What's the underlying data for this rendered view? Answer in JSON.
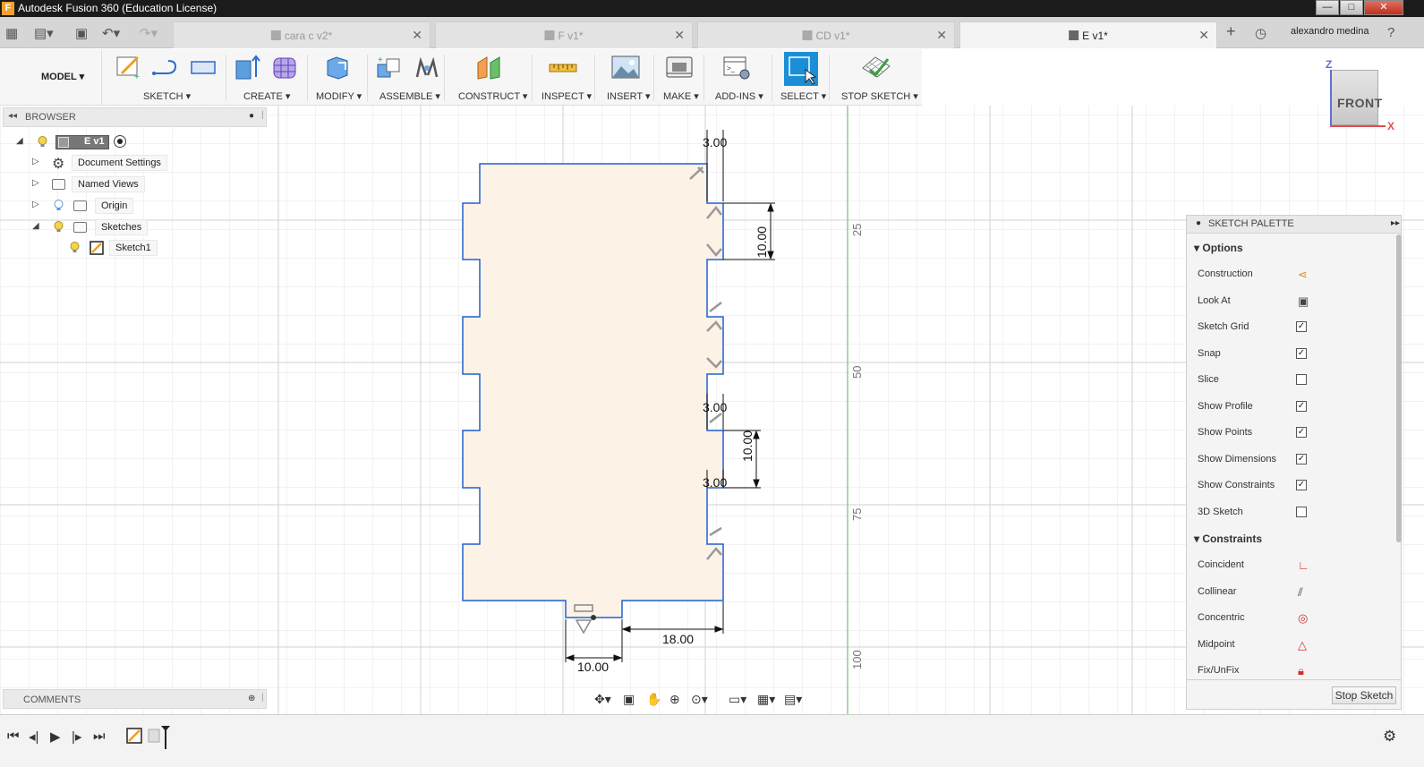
{
  "window": {
    "title": "Autodesk Fusion 360 (Education License)",
    "app_letter": "F",
    "minimize": "—",
    "maximize": "□",
    "close": "✕"
  },
  "tabs": [
    {
      "label": "cara c v2*",
      "active": false
    },
    {
      "label": "F v1*",
      "active": false
    },
    {
      "label": "CD v1*",
      "active": false
    },
    {
      "label": "E v1*",
      "active": true
    }
  ],
  "tab_close": "✕",
  "user": {
    "name": "alexandro medina"
  },
  "toolbar": {
    "workspace": "MODEL ▾",
    "groups": [
      "SKETCH ▾",
      "CREATE ▾",
      "MODIFY ▾",
      "ASSEMBLE ▾",
      "CONSTRUCT ▾",
      "INSPECT ▾",
      "INSERT ▾",
      "MAKE ▾",
      "ADD-INS ▾",
      "SELECT ▾",
      "STOP SKETCH ▾"
    ]
  },
  "browser": {
    "title": "BROWSER",
    "root": "E v1",
    "items": [
      "Document Settings",
      "Named Views",
      "Origin",
      "Sketches"
    ],
    "sketch": "Sketch1"
  },
  "comments": {
    "title": "COMMENTS"
  },
  "dimensions": {
    "d_top_3": "3.00",
    "d_10_a": "10.00",
    "d_mid_3": "3.00",
    "d_10_b": "10.00",
    "d_low_3": "3.00",
    "d_18": "18.00",
    "d_bottom_10": "10.00"
  },
  "ruler": {
    "r25": "25",
    "r50": "50",
    "r75": "75",
    "r100": "100"
  },
  "viewcube": {
    "face": "FRONT",
    "z": "Z",
    "x": "X"
  },
  "palette": {
    "title": "SKETCH PALETTE",
    "options_title": "Options",
    "options": [
      {
        "label": "Construction",
        "type": "icon"
      },
      {
        "label": "Look At",
        "type": "icon"
      },
      {
        "label": "Sketch Grid",
        "type": "check",
        "checked": true
      },
      {
        "label": "Snap",
        "type": "check",
        "checked": true
      },
      {
        "label": "Slice",
        "type": "check",
        "checked": false
      },
      {
        "label": "Show Profile",
        "type": "check",
        "checked": true
      },
      {
        "label": "Show Points",
        "type": "check",
        "checked": true
      },
      {
        "label": "Show Dimensions",
        "type": "check",
        "checked": true
      },
      {
        "label": "Show Constraints",
        "type": "check",
        "checked": true
      },
      {
        "label": "3D Sketch",
        "type": "check",
        "checked": false
      }
    ],
    "constraints_title": "Constraints",
    "constraints": [
      "Coincident",
      "Collinear",
      "Concentric",
      "Midpoint",
      "Fix/UnFix"
    ],
    "stop_button": "Stop Sketch"
  },
  "colors": {
    "profile_fill": "#fdf2e6",
    "sketch_line": "#2060d0",
    "accent_select": "#1a8fd8",
    "grid": "#e4e4e4",
    "axis_green": "#60c060",
    "axis_red": "#e05050"
  }
}
